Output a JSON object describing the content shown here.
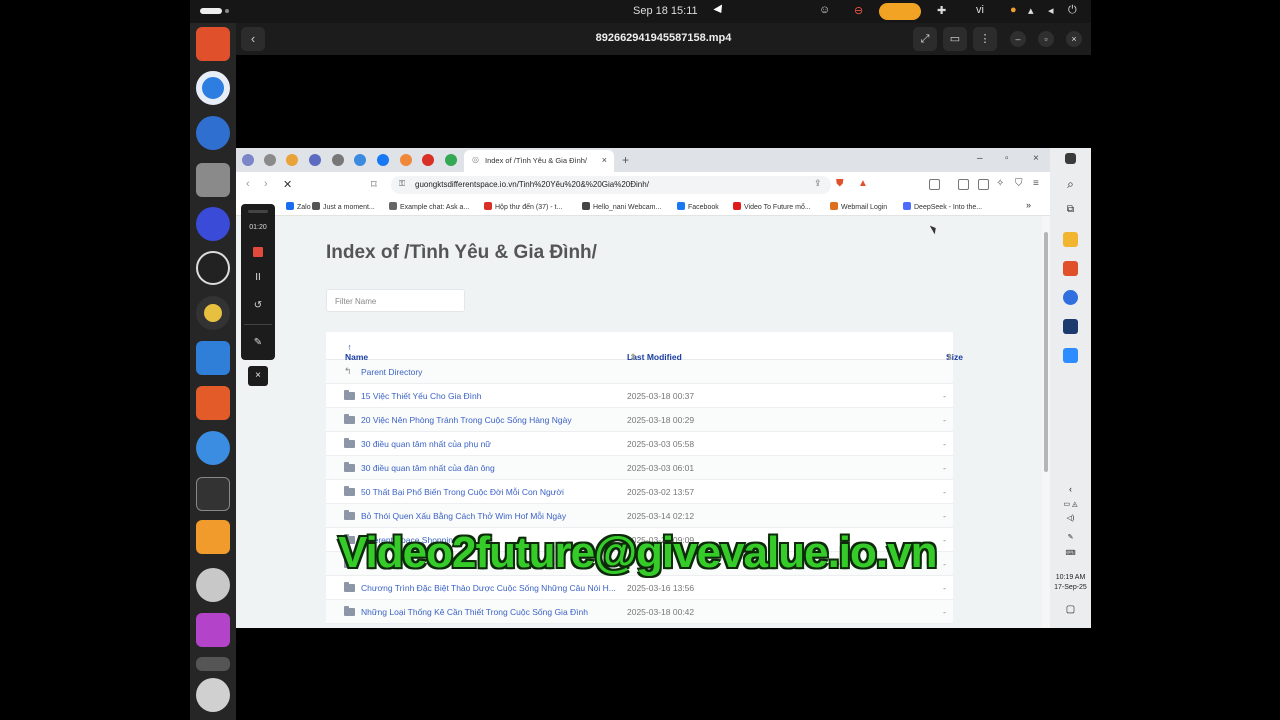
{
  "topbar": {
    "clock": "Sep 18  15:11",
    "language": "vi"
  },
  "player": {
    "back": "‹",
    "title": "892662941945587158.mp4",
    "expand": "⤢",
    "subtitles": "▭",
    "menu": "⋮",
    "minimize": "–",
    "restore": "▫",
    "close": "×"
  },
  "browser": {
    "tab_title": "Index of /Tình Yêu & Gia Đình/",
    "tab_close": "×",
    "new_tab": "+",
    "url": "guongktsdifferentspace.io.vn/Tinh%20Yêu%20&%20Gia%20Đinh/",
    "bookmarks": [
      {
        "label": "Zalo",
        "color": "#1a6df0"
      },
      {
        "label": "Just a moment...",
        "color": "#555555"
      },
      {
        "label": "Example chat: Ask a...",
        "color": "#666666"
      },
      {
        "label": "Hộp thư đến (37) - t...",
        "color": "#d93025"
      },
      {
        "label": "Hello_nani Webcam...",
        "color": "#444444"
      },
      {
        "label": "Facebook",
        "color": "#1877f2"
      },
      {
        "label": "Video To Future mổ...",
        "color": "#e01b1b"
      },
      {
        "label": "Webmail Login",
        "color": "#e06f1b"
      },
      {
        "label": "DeepSeek - Into the...",
        "color": "#4d6bfe"
      }
    ],
    "bookmarks_more": "»"
  },
  "page": {
    "heading": "Index of /Tình Yêu & Gia Đình/",
    "filter_placeholder": "Filter Name",
    "columns": {
      "name": "Name",
      "modified": "Last Modified",
      "size": "Size"
    },
    "parent": "Parent Directory",
    "rows": [
      {
        "name": "15 Việc Thiết Yếu Cho Gia Đình",
        "date": "2025-03-18 00:37",
        "size": "-"
      },
      {
        "name": "20 Việc Nên Phòng Tránh Trong Cuộc Sống Hàng Ngày",
        "date": "2025-03-18 00:29",
        "size": "-"
      },
      {
        "name": "30 điều quan tâm nhất của phụ nữ",
        "date": "2025-03-03 05:58",
        "size": "-"
      },
      {
        "name": "30 điều quan tâm nhất của đàn ông",
        "date": "2025-03-03 06:01",
        "size": "-"
      },
      {
        "name": "50 Thất Bại Phổ Biến Trong Cuộc Đời Mỗi Con Người",
        "date": "2025-03-02 13:57",
        "size": "-"
      },
      {
        "name": "Bỏ Thói Quen Xấu Bằng Cách Thở Wim Hof Mỗi Ngày",
        "date": "2025-03-14 02:12",
        "size": "-"
      },
      {
        "name": "Different Space Shopping Vi...",
        "date": "2025-03-25 09:09",
        "size": "-"
      },
      {
        "name": "",
        "date": "",
        "size": "-"
      },
      {
        "name": "Chương Trình Đặc Biệt Thảo Dược Cuộc Sống Những Câu Nói H...",
        "date": "2025-03-16 13:56",
        "size": "-"
      },
      {
        "name": "Những Loại Thống Kê Cần Thiết Trong Cuộc Sống Gia Đình",
        "date": "2025-03-18 00:42",
        "size": "-"
      }
    ]
  },
  "recorder": {
    "time": "01:20",
    "pause": "II",
    "undo": "↺",
    "pen": "✎",
    "close": "×"
  },
  "windows": {
    "time": "10:19 AM",
    "date": "17-Sep-25"
  },
  "watermark": "Video2future@givevalue.io.vn"
}
